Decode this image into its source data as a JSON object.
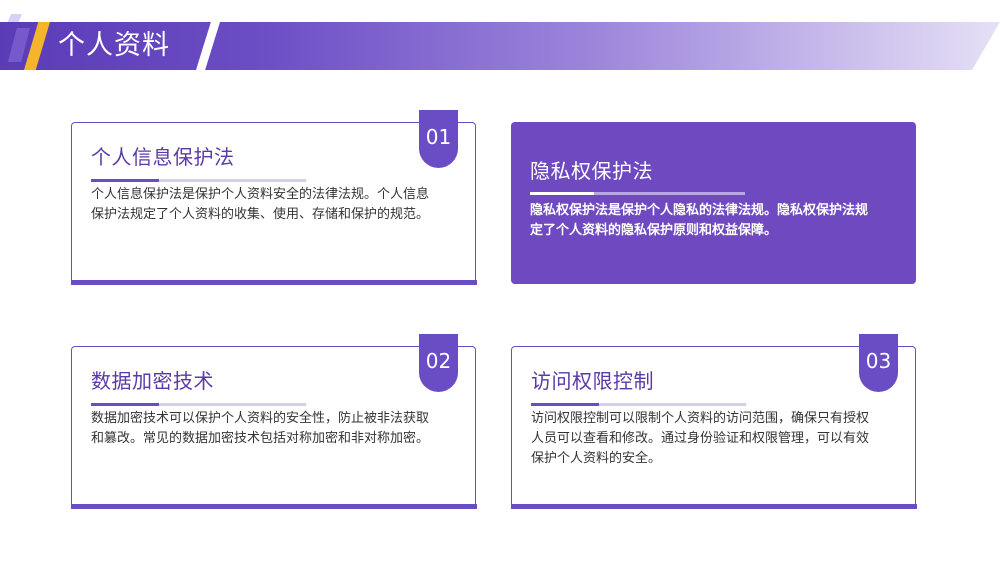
{
  "header": {
    "title": "个人资料"
  },
  "cards": [
    {
      "title": "个人信息保护法",
      "body": "个人信息保护法是保护个人资料安全的法律法规。个人信息保护法规定了个人资料的收集、使用、存储和保护的规范。",
      "number": "01"
    },
    {
      "title": "隐私权保护法",
      "body": "隐私权保护法是保护个人隐私的法律法规。隐私权保护法规定了个人资料的隐私保护原则和权益保障。",
      "number": ""
    },
    {
      "title": "数据加密技术",
      "body": "数据加密技术可以保护个人资料的安全性，防止被非法获取和篡改。常见的数据加密技术包括对称加密和非对称加密。",
      "number": "02"
    },
    {
      "title": "访问权限控制",
      "body": "访问权限控制可以限制个人资料的访问范围，确保只有授权人员可以查看和修改。通过身份验证和权限管理，可以有效保护个人资料的安全。",
      "number": "03"
    }
  ],
  "colors": {
    "primary": "#6a4cc4",
    "accent": "#f5b52a",
    "filled_card": "#6f49c0"
  }
}
